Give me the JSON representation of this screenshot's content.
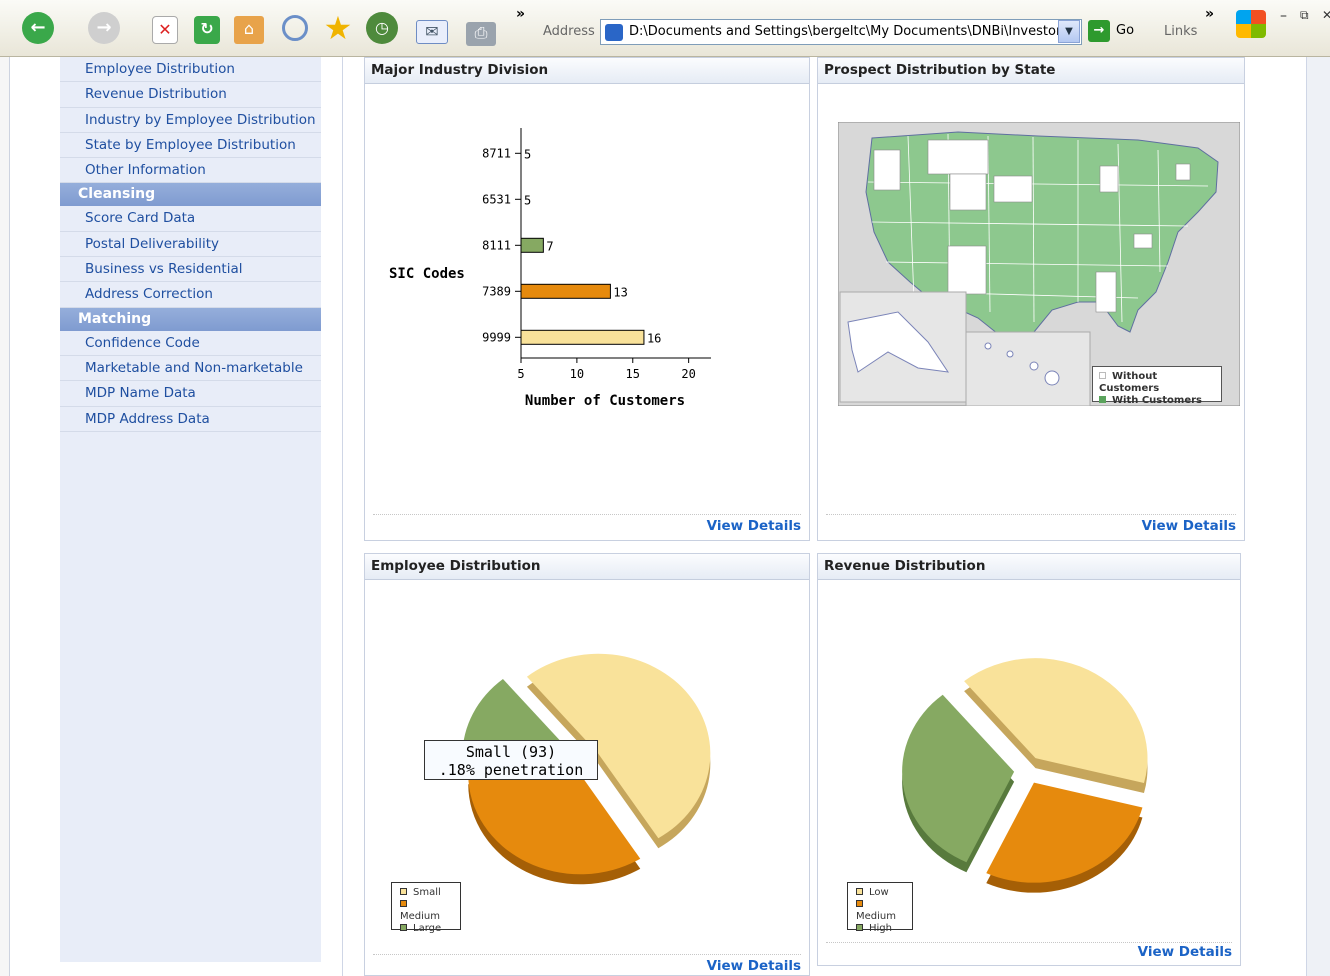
{
  "browser": {
    "address_label": "Address",
    "address_value": "D:\\Documents and Settings\\bergeltc\\My Documents\\DNBi\\Investor D",
    "go_label": "Go",
    "links_label": "Links",
    "more_symbol": "»"
  },
  "nav": {
    "items_top": [
      "Employee Distribution",
      "Revenue Distribution",
      "Industry by Employee Distribution",
      "State by Employee Distribution",
      "Other Information"
    ],
    "cleansing_header": "Cleansing",
    "cleansing_items": [
      "Score Card Data",
      "Postal Deliverability",
      "Business vs Residential",
      "Address Correction"
    ],
    "matching_header": "Matching",
    "matching_items": [
      "Confidence Code",
      "Marketable and Non-marketable",
      "MDP Name Data",
      "MDP Address Data"
    ]
  },
  "panels": {
    "industry": {
      "title": "Major Industry Division",
      "details": "View Details"
    },
    "state": {
      "title": "Prospect Distribution by State",
      "details": "View Details",
      "legend": [
        "Without Customers",
        "With Customers"
      ]
    },
    "employee": {
      "title": "Employee Distribution",
      "details": "View Details",
      "tooltip_line1": "Small (93)",
      "tooltip_line2": ".18% penetration",
      "legend": [
        "Small",
        "Medium",
        "Large"
      ]
    },
    "revenue": {
      "title": "Revenue Distribution",
      "details": "View Details",
      "legend": [
        "Low",
        "Medium",
        "High"
      ]
    }
  },
  "colors": {
    "small": "#f9e29a",
    "medium": "#e68a0d",
    "large": "#86a962",
    "map_green": "#8dc88e",
    "link": "#1b63c6"
  },
  "chart_data": [
    {
      "type": "bar",
      "orientation": "horizontal",
      "categories": [
        "8711",
        "6531",
        "8111",
        "7389",
        "9999"
      ],
      "values": [
        5,
        5,
        7,
        13,
        16
      ],
      "xlabel": "Number of Customers",
      "ylabel": "SIC Codes",
      "xlim": [
        5,
        22
      ],
      "xticks": [
        5,
        10,
        15,
        20
      ],
      "bar_colors": [
        "#ffffff",
        "#ffffff",
        "#86a962",
        "#e68a0d",
        "#f9e29a"
      ]
    },
    {
      "type": "pie",
      "labels": [
        "Small",
        "Medium",
        "Large"
      ],
      "values": [
        52,
        34,
        14
      ]
    },
    {
      "type": "pie",
      "labels": [
        "Low",
        "Medium",
        "High"
      ],
      "values": [
        40,
        28,
        32
      ]
    }
  ]
}
